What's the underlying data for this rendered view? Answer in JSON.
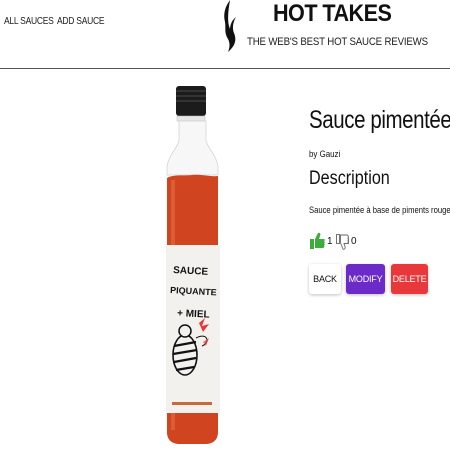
{
  "nav": {
    "all_sauces": "ALL SAUCES",
    "add_sauce": "ADD SAUCE"
  },
  "header": {
    "title": "HOT TAKES",
    "tagline": "THE WEB'S BEST HOT SAUCE REVIEWS",
    "logo_icon": "flame-icon"
  },
  "sauce": {
    "name": "Sauce pimentée",
    "manufacturer": "by Gauzi",
    "description_heading": "Description",
    "description": "Sauce pimentée à base de piments rouges",
    "likes": "1",
    "dislikes": "0",
    "image_alt": "Sauce piquante + miel bottle",
    "label_lines": [
      "SAUCE",
      "PIQUANTE",
      "+ MIEL"
    ]
  },
  "actions": {
    "back_label": "BACK",
    "modify_label": "MODIFY",
    "delete_label": "DELETE"
  },
  "colors": {
    "modify": "#6c2bc8",
    "delete": "#e9383b",
    "like": "#3dab3d",
    "sauce": "#d0441f"
  }
}
